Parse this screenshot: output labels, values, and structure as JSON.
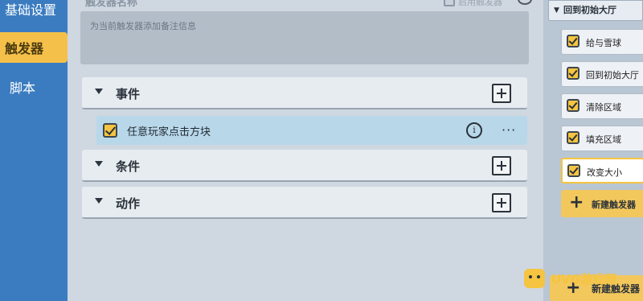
{
  "sidebar": {
    "items": [
      {
        "label": "基础设置"
      },
      {
        "label": "触发器"
      },
      {
        "label": "脚本"
      }
    ]
  },
  "center": {
    "clipped_title": "触发器名称",
    "clipped_checkbox_label": "启用触发器",
    "note_placeholder": "为当前触发器添加备注信息",
    "events": {
      "label": "事件",
      "items": [
        {
          "label": "任意玩家点击方块"
        }
      ]
    },
    "conditions": {
      "label": "条件"
    },
    "actions": {
      "label": "动作"
    },
    "more_glyph": "···",
    "info_glyph": "i"
  },
  "right": {
    "header": "回到初始大厅",
    "triggers": [
      {
        "label": "给与雪球"
      },
      {
        "label": "回到初始大厅"
      },
      {
        "label": "清除区域"
      },
      {
        "label": "填充区域"
      },
      {
        "label": "改变大小"
      }
    ],
    "new_trigger_label": "新建触发器",
    "new_trigger_label_bottom": "新建触发器"
  },
  "watermark": {
    "text": "UVG游戏网"
  },
  "colors": {
    "sidebar_bg": "#3b7cc0",
    "accent_yellow": "#f5c440",
    "selected_row": "#b8d8ea"
  }
}
